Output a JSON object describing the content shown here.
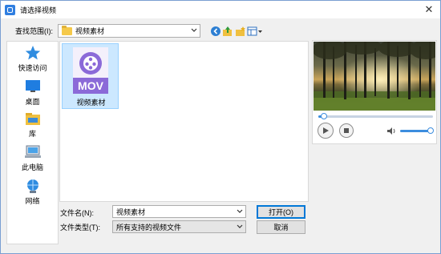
{
  "window": {
    "title": "请选择视频",
    "close_glyph": "✕"
  },
  "toolbar": {
    "lookin_label": "查找范围(I):",
    "lookin_value": "视频素材",
    "icons": [
      "back-icon",
      "up-folder-icon",
      "new-folder-icon",
      "view-menu-icon"
    ]
  },
  "places": [
    {
      "label": "快速访问",
      "icon": "star-icon"
    },
    {
      "label": "桌面",
      "icon": "desktop-icon"
    },
    {
      "label": "库",
      "icon": "library-icon"
    },
    {
      "label": "此电脑",
      "icon": "computer-icon"
    },
    {
      "label": "网络",
      "icon": "network-icon"
    }
  ],
  "files": [
    {
      "name": "视频素材",
      "badge": "MOV",
      "icon": "mov-file-icon"
    }
  ],
  "form": {
    "filename_label": "文件名(N):",
    "filename_value": "视频素材",
    "filetype_label": "文件类型(T):",
    "filetype_value": "所有支持的视频文件",
    "open_label": "打开(O)",
    "cancel_label": "取消"
  },
  "preview": {
    "progress": 0.05,
    "volume": 1.0
  },
  "colors": {
    "accent": "#0078d7",
    "selection": "#cce8ff",
    "mov_purple": "#8b6ad8",
    "slider": "#3c8dde"
  }
}
